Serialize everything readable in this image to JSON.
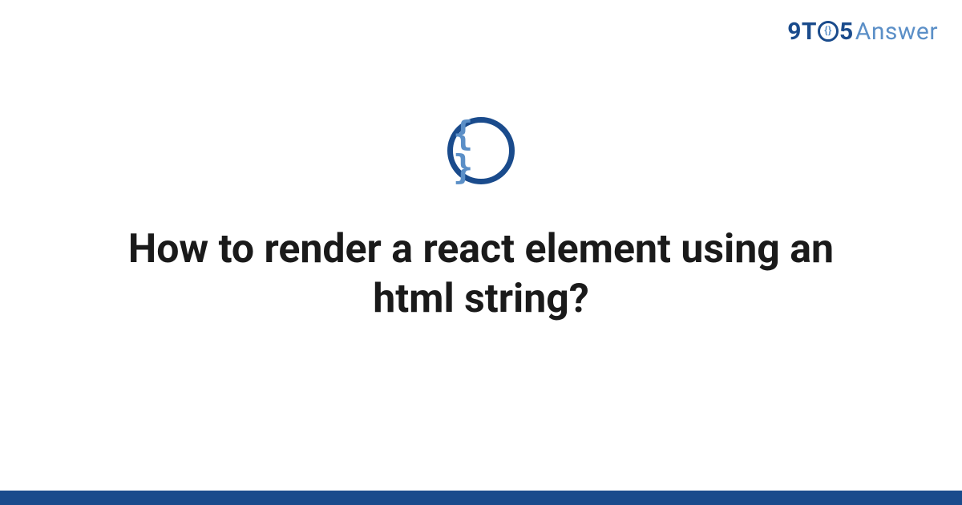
{
  "brand": {
    "part_9t": "9T",
    "part_o_inner": "{}",
    "part_5": "5",
    "part_answer": "Answer"
  },
  "topic_icon": {
    "symbol": "{ }",
    "semantic": "code-braces-icon"
  },
  "question": {
    "title": "How to render a react element using an html string?"
  },
  "colors": {
    "primary": "#1a4b8c",
    "accent": "#5b8fc7",
    "text": "#1a1a1a",
    "background": "#ffffff"
  }
}
